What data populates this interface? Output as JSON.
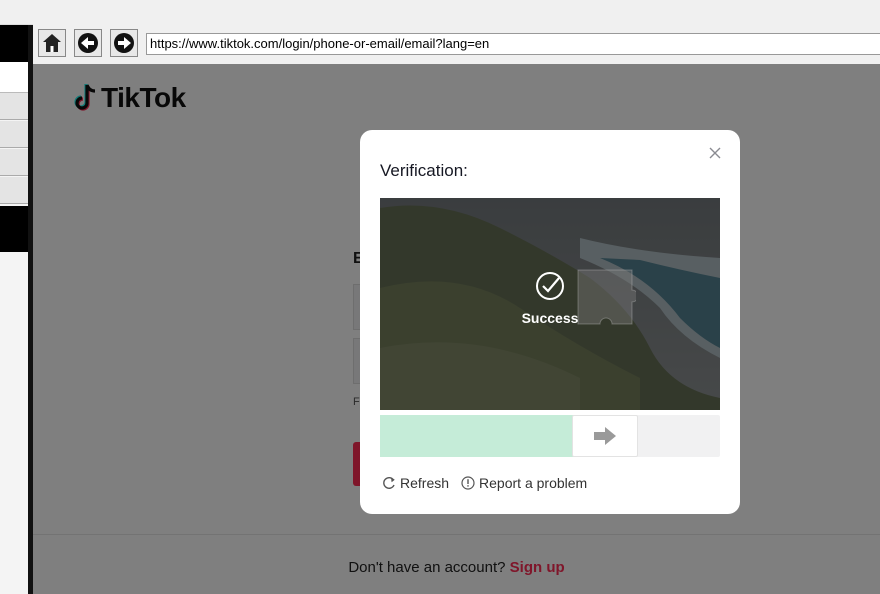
{
  "browser": {
    "url": "https://www.tiktok.com/login/phone-or-email/email?lang=en",
    "buttons": [
      "home-icon",
      "back-icon",
      "forward-icon"
    ]
  },
  "page": {
    "logo_text": "TikTok",
    "heading_initial": "E",
    "small_initial": "F",
    "footer": {
      "prompt": "Don't have an account?",
      "signup": "Sign up"
    }
  },
  "modal": {
    "title": "Verification:",
    "success_text": "Success",
    "slider_progress_percent": 57,
    "refresh_label": "Refresh",
    "report_label": "Report a problem"
  },
  "colors": {
    "brand": "#fe2c55",
    "slider_fill": "#c5ecd8",
    "overlay": "rgba(0,0,0,0.5)"
  }
}
